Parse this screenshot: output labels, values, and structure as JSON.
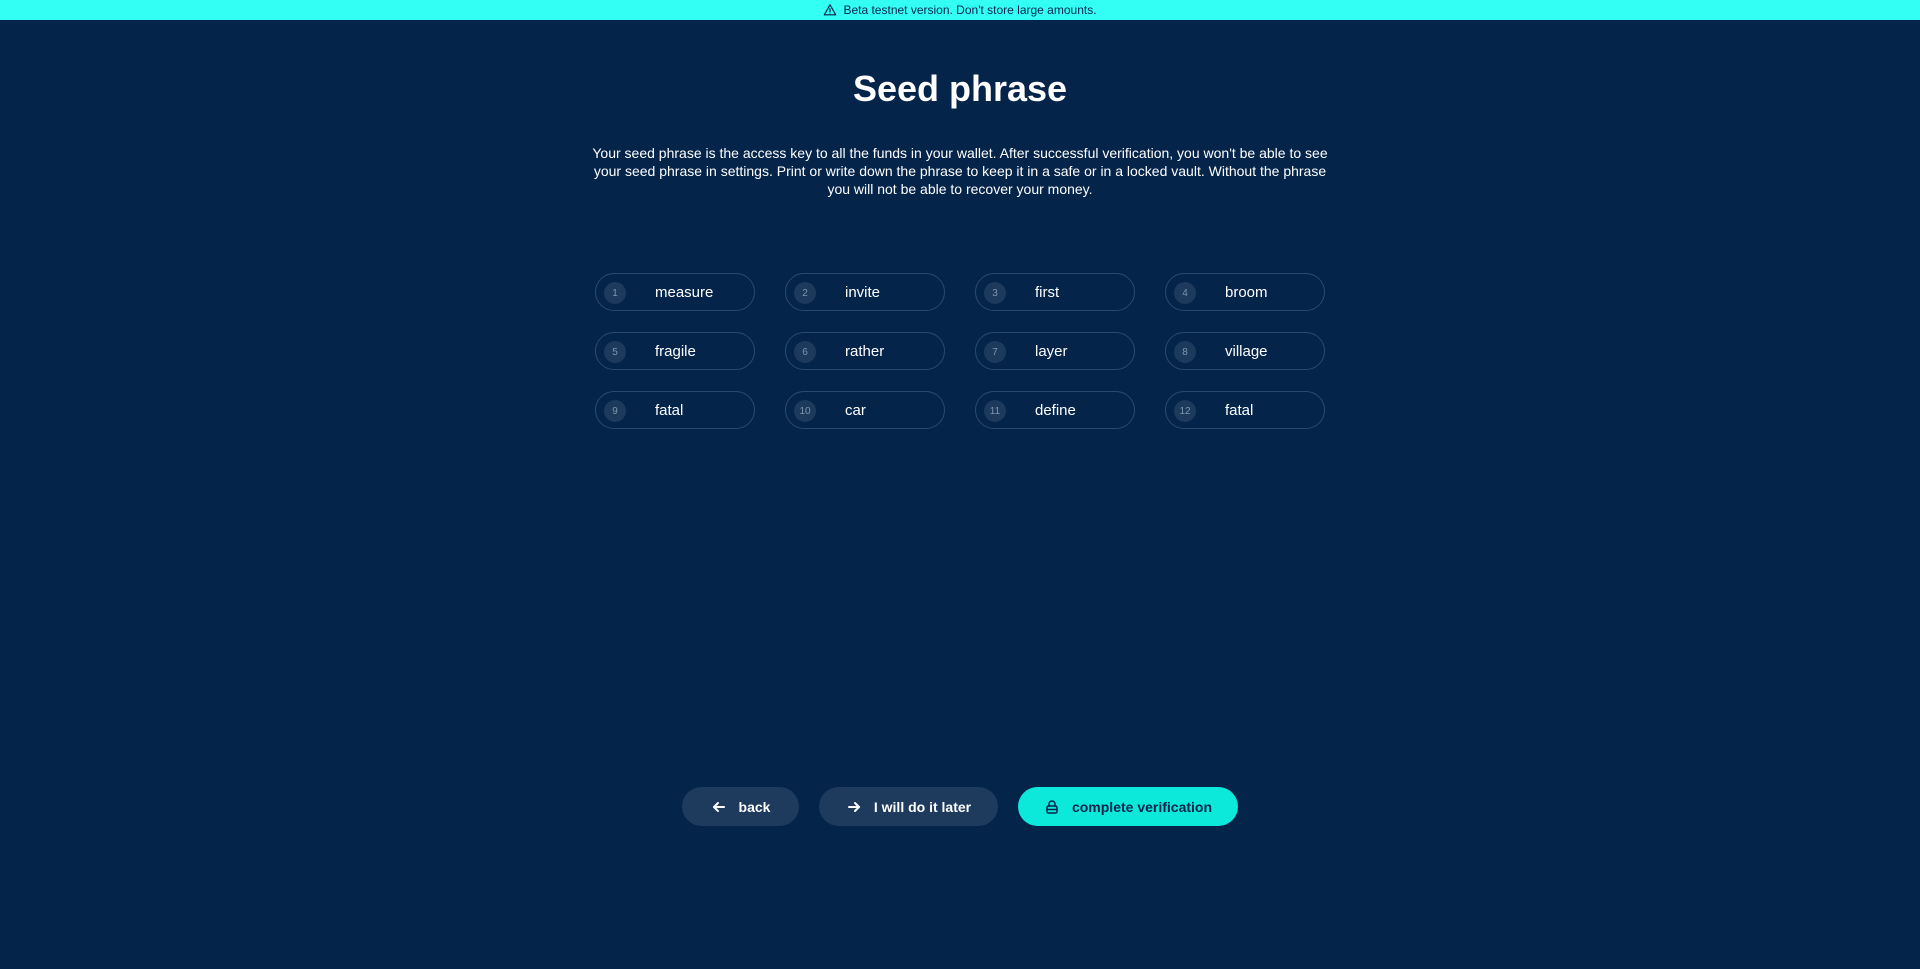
{
  "banner": {
    "icon": "warning-icon",
    "text": "Beta testnet version. Don't store large amounts."
  },
  "page": {
    "title": "Seed phrase",
    "description": "Your seed phrase is the access key to all the funds in your wallet. After successful verification, you won't be able to see your seed phrase in settings. Print or write down the phrase to keep it in a safe or in a locked vault. Without the phrase you will not be able to recover your money."
  },
  "seed_words": [
    {
      "num": "1",
      "word": "measure"
    },
    {
      "num": "2",
      "word": "invite"
    },
    {
      "num": "3",
      "word": "first"
    },
    {
      "num": "4",
      "word": "broom"
    },
    {
      "num": "5",
      "word": "fragile"
    },
    {
      "num": "6",
      "word": "rather"
    },
    {
      "num": "7",
      "word": "layer"
    },
    {
      "num": "8",
      "word": "village"
    },
    {
      "num": "9",
      "word": "fatal"
    },
    {
      "num": "10",
      "word": "car"
    },
    {
      "num": "11",
      "word": "define"
    },
    {
      "num": "12",
      "word": "fatal"
    }
  ],
  "actions": {
    "back": {
      "label": "back",
      "icon": "arrow-left-icon"
    },
    "later": {
      "label": "I will do it later",
      "icon": "arrow-right-icon"
    },
    "complete": {
      "label": "complete verification",
      "icon": "lock-icon"
    }
  },
  "colors": {
    "background": "#04244a",
    "banner": "#33fff5",
    "accent": "#0ce8d9",
    "secondary_button": "#1e3a5c"
  }
}
